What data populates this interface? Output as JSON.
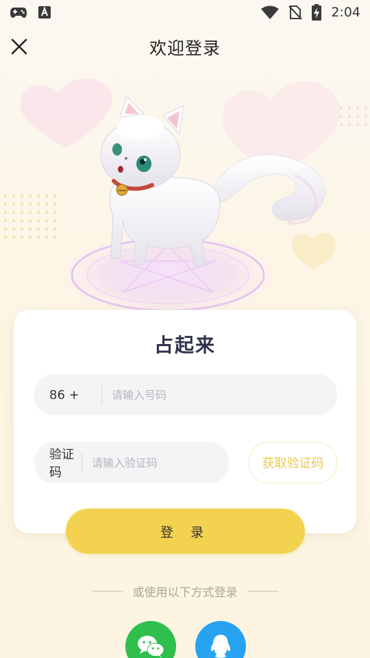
{
  "status_bar": {
    "time": "2:04",
    "left_icons": [
      "gamepad-icon",
      "font-a-icon"
    ],
    "right_icons": [
      "wifi-icon",
      "no-sim-icon",
      "battery-charging-icon"
    ]
  },
  "header": {
    "title": "欢迎登录",
    "close_icon": "close-icon"
  },
  "card": {
    "brand": "占起来",
    "phone": {
      "prefix": "86 +",
      "placeholder": "请输入号码",
      "value": ""
    },
    "code": {
      "label": "验证码",
      "placeholder": "请输入验证码",
      "value": ""
    },
    "get_code_label": "获取验证码"
  },
  "login_label": "登 录",
  "alt_login": {
    "text": "或使用以下方式登录",
    "providers": [
      {
        "name": "wechat",
        "icon": "wechat-icon",
        "color": "#2fbf4d"
      },
      {
        "name": "qq",
        "icon": "qq-icon",
        "color": "#26a2f0"
      }
    ]
  },
  "colors": {
    "accent": "#f2d24f",
    "get_code_text": "#e9c94c",
    "brand_text": "#2f3249"
  }
}
